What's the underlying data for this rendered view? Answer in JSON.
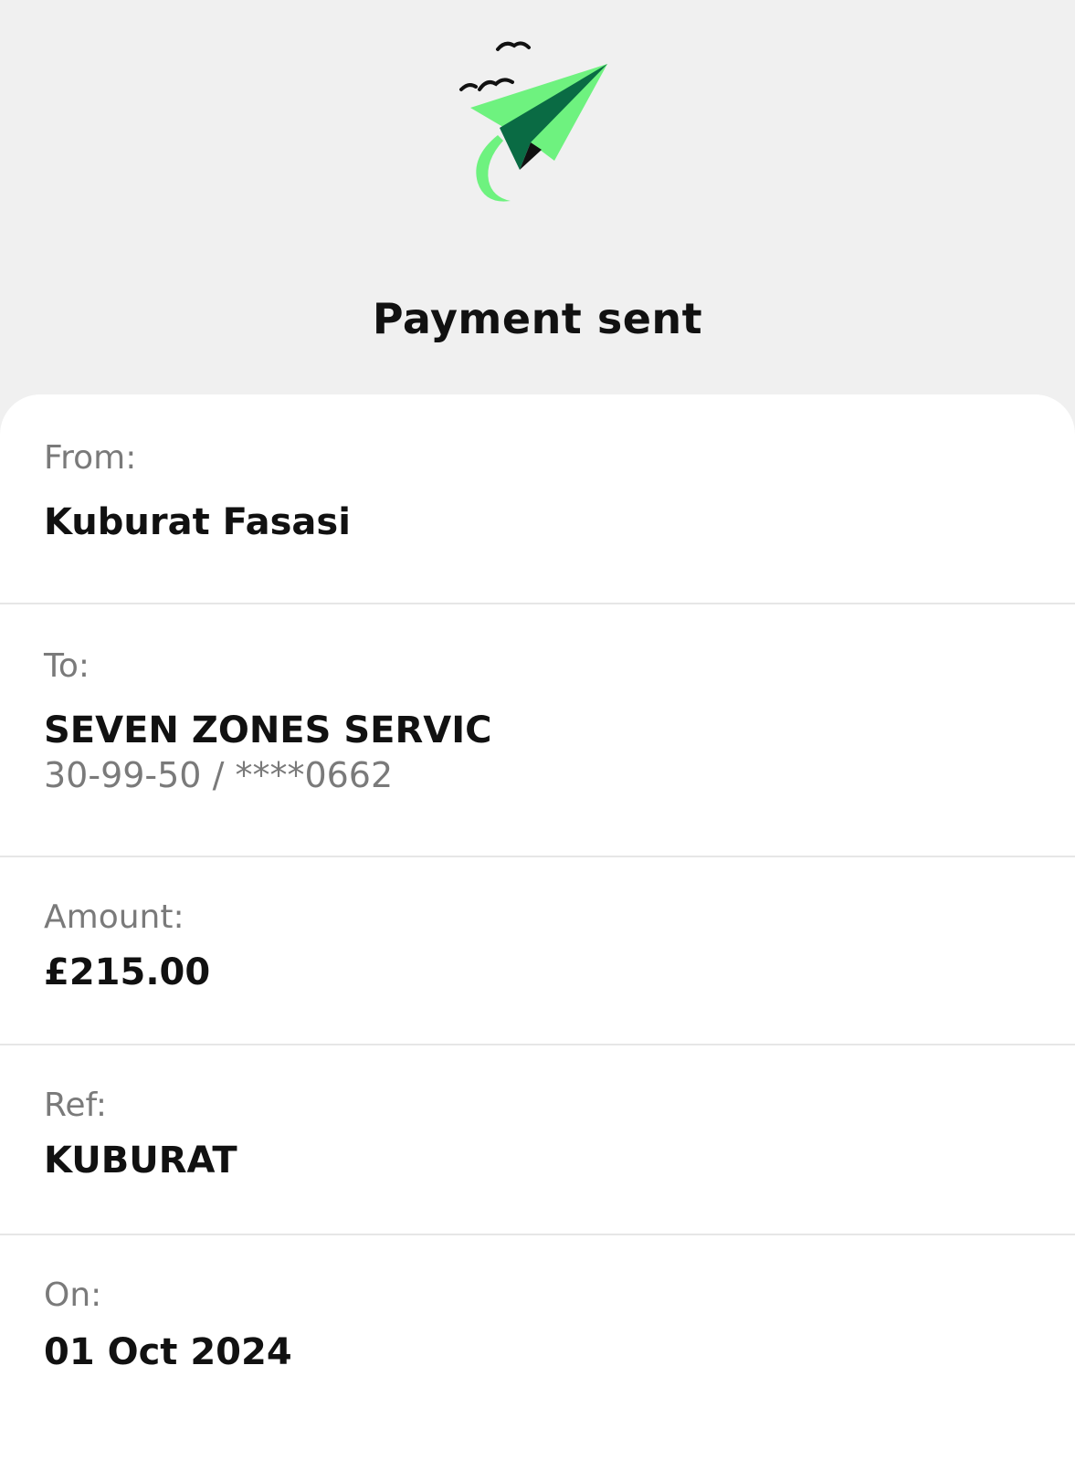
{
  "header": {
    "title": "Payment sent",
    "illustration_icon": "paper-plane-icon",
    "accent_light": "#6ef27f",
    "accent_dark": "#0a6b44"
  },
  "details": {
    "from": {
      "label": "From:",
      "value": "Kuburat Fasasi"
    },
    "to": {
      "label": "To:",
      "value": "SEVEN ZONES SERVIC",
      "account": "30-99-50 / ****0662"
    },
    "amount": {
      "label": "Amount:",
      "value": "£215.00"
    },
    "ref": {
      "label": "Ref:",
      "value": "KUBURAT"
    },
    "on": {
      "label": "On:",
      "value": "01 Oct 2024"
    }
  }
}
